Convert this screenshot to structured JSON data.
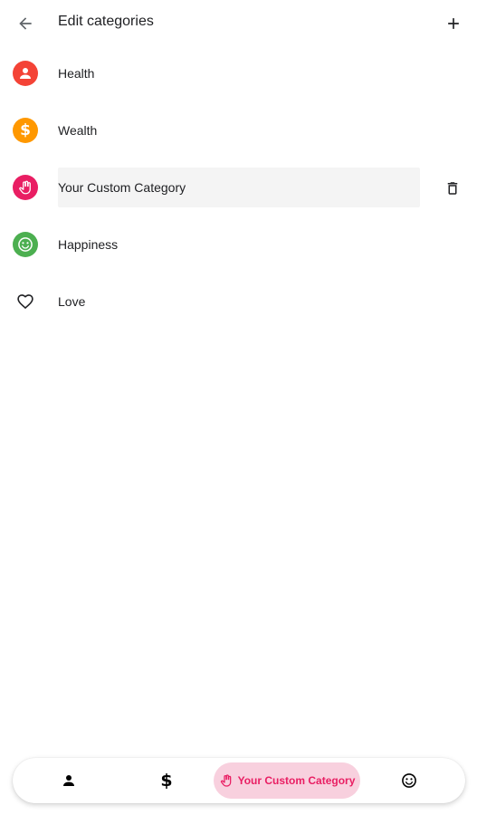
{
  "appbar": {
    "title": "Edit categories",
    "back_icon": "arrow-back-icon",
    "add_icon": "plus-icon"
  },
  "categories": [
    {
      "label": "Health",
      "icon": "person-icon",
      "color": "#f44336"
    },
    {
      "label": "Wealth",
      "icon": "dollar-icon",
      "color": "#ff9800"
    },
    {
      "label": "Your Custom Category",
      "icon": "hand-icon",
      "color": "#e91e63",
      "selected": true
    },
    {
      "label": "Happiness",
      "icon": "smiley-icon",
      "color": "#4caf50"
    },
    {
      "label": "Love",
      "icon": "heart-outline-icon",
      "color": "#000000"
    }
  ],
  "delete_icon": "trash-icon",
  "tabbar": {
    "tabs": [
      {
        "icon": "person-icon"
      },
      {
        "icon": "dollar-icon"
      },
      {
        "icon": "hand-icon",
        "label": "Your Custom Category",
        "active": true
      },
      {
        "icon": "smiley-icon"
      }
    ],
    "active_bg": "#f8d0de",
    "active_color": "#e91e63"
  }
}
